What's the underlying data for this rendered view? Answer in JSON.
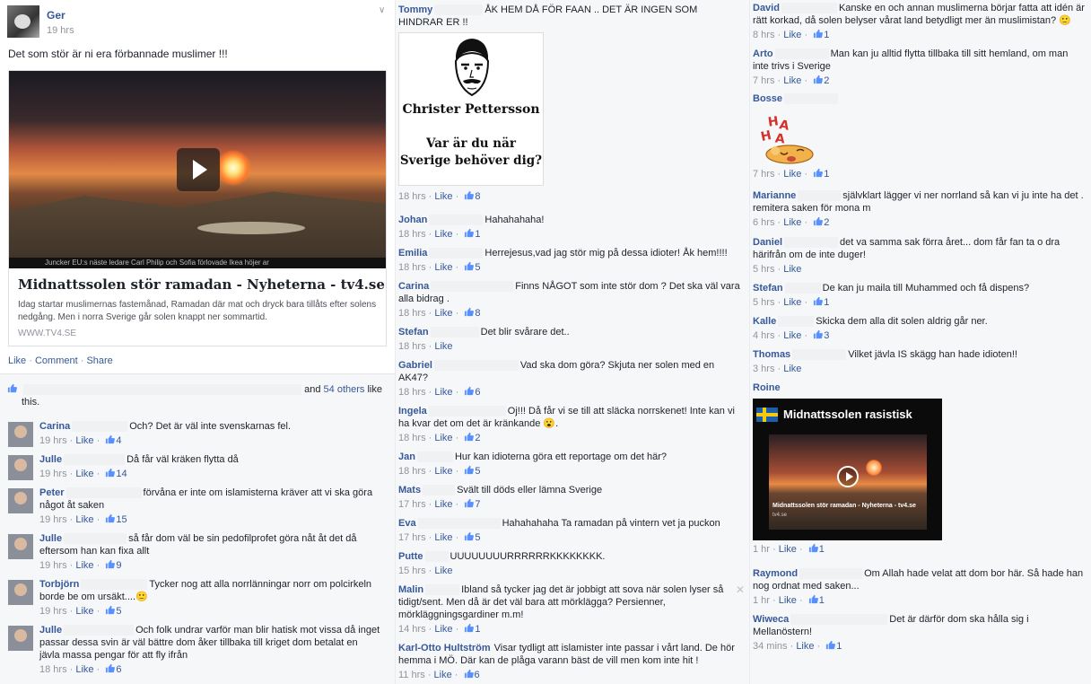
{
  "post": {
    "author": "Ger",
    "time": "19 hrs",
    "text": "Det som stör är ni era förbannade muslimer !!!",
    "card": {
      "title": "Midnattssolen stör ramadan - Nyheterna - tv4.se",
      "description": "Idag startar muslimernas fastemånad, Ramadan där mat och dryck bara tillåts efter solens nedgång. Men i norra Sverige går solen knappt ner sommartid.",
      "source": "WWW.TV4.SE",
      "ticker": "Juncker EU:s näste ledare        Carl Philip och Sofia förlovade        Ikea höjer ar"
    },
    "actions": {
      "like": "Like",
      "comment": "Comment",
      "share": "Share",
      "sep": " · "
    },
    "likes_text": "and",
    "likes_others": "54 others",
    "likes_suffix": "like",
    "likes_line2": "this."
  },
  "comments_col1": [
    {
      "name": "Carina",
      "text": "Och? Det är väl inte svenskarnas fel.",
      "time": "19 hrs",
      "likes": "4"
    },
    {
      "name": "Julle",
      "text": "Då får väl kräken flytta då",
      "time": "19 hrs",
      "likes": "14"
    },
    {
      "name": "Peter",
      "text": "förvåna er inte om islamisterna kräver att vi ska göra något åt saken",
      "time": "19 hrs",
      "likes": "15"
    },
    {
      "name": "Julle",
      "text": "så får dom väl be sin pedofilprofet göra nåt åt det då eftersom han kan fixa allt",
      "time": "19 hrs",
      "likes": "9"
    },
    {
      "name": "Torbjörn",
      "text": "Tycker nog att alla norrlänningar norr om polcirkeln borde be om ursäkt....🙂",
      "time": "19 hrs",
      "likes": "5"
    },
    {
      "name": "Julle",
      "text": "Och folk undrar varför man blir hatisk mot vissa då inget passar dessa svin är väl bättre dom åker tillbaka till kriget dom betalat en jävla massa pengar för att fly ifrån",
      "time": "18 hrs",
      "likes": "6"
    }
  ],
  "comments_col2": [
    {
      "name": "Tommy",
      "text": "ÅK HEM DÅ FÖR FAAN .. DET ÄR INGEN SOM HINDRAR ER !!",
      "time": "18 hrs",
      "likes": "8"
    },
    {
      "name": "Johan",
      "text": "Hahahahaha!",
      "time": "18 hrs",
      "likes": "1"
    },
    {
      "name": "Emilia",
      "text": "Herrejesus,vad jag stör mig på dessa idioter! Åk hem!!!!",
      "time": "18 hrs",
      "likes": "5"
    },
    {
      "name": "Carina",
      "text": "Finns NÅGOT som inte stör dom ? Det ska väl vara alla bidrag .",
      "time": "18 hrs",
      "likes": "8"
    },
    {
      "name": "Stefan",
      "text": "Det blir svårare det..",
      "time": "18 hrs",
      "likes": ""
    },
    {
      "name": "Gabriel",
      "text": "Vad ska dom göra? Skjuta ner solen med en AK47?",
      "time": "18 hrs",
      "likes": "6"
    },
    {
      "name": "Ingela",
      "text": "Oj!!! Då får vi se till att släcka norrskenet! Inte kan vi ha kvar det om det är kränkande 😮.",
      "time": "18 hrs",
      "likes": "2"
    },
    {
      "name": "Jan",
      "text": "Hur kan idioterna göra ett reportage om det här?",
      "time": "18 hrs",
      "likes": "5"
    },
    {
      "name": "Mats",
      "text": "Svält till döds eller lämna Sverige",
      "time": "17 hrs",
      "likes": "7"
    },
    {
      "name": "Eva",
      "text": "Hahahahaha Ta ramadan på vintern vet ja puckon",
      "time": "17 hrs",
      "likes": "5"
    },
    {
      "name": "Putte",
      "text": "UUUUUUUURRRRRRKKKKKKKK.",
      "time": "15 hrs",
      "likes": ""
    },
    {
      "name": "Malin",
      "text": "Ibland så tycker jag det är jobbigt att sova när solen lyser så tidigt/sent. Men då är det väl bara att mörklägga? Persienner, mörkläggningsgardiner m.m!",
      "time": "14 hrs",
      "likes": "1"
    },
    {
      "name": "Karl-Otto Hultström",
      "text": "Visar tydligt att islamister inte passar i vårt land. De hör hemma i MÖ. Där kan de plåga varann bäst de vill men kom inte hit !",
      "time": "11 hrs",
      "likes": "6"
    }
  ],
  "christer_image": {
    "name": "Christer Pettersson",
    "question": "Var är du när Sverige behöver dig?"
  },
  "comments_col3": [
    {
      "name": "David",
      "text": "Kanske en och annan muslimerna börjar fatta att idén är rätt korkad, då solen belyser vårat land betydligt mer än muslimistan? 🙂",
      "time": "8 hrs",
      "likes": "1"
    },
    {
      "name": "Arto",
      "text": "Man kan ju alltid flytta tillbaka till sitt hemland, om man inte trivs i Sverige",
      "time": "7 hrs",
      "likes": "2"
    },
    {
      "name": "Bosse",
      "text": "",
      "time": "7 hrs",
      "likes": "1"
    },
    {
      "name": "Marianne",
      "text": "självklart lägger vi ner norrland så kan vi ju inte ha det . remitera saken för mona m",
      "time": "6 hrs",
      "likes": "2"
    },
    {
      "name": "Daniel",
      "text": "det va samma sak förra året... dom får fan ta o dra härifrån om de inte duger!",
      "time": "5 hrs",
      "likes": ""
    },
    {
      "name": "Stefan",
      "text": "De kan ju maila till Muhammed och få dispens?",
      "time": "5 hrs",
      "likes": "1"
    },
    {
      "name": "Kalle",
      "text": "Skicka dem alla dit solen aldrig går ner.",
      "time": "4 hrs",
      "likes": "3"
    },
    {
      "name": "Thomas",
      "text": "Vilket jävla IS skägg han hade idioten!!",
      "time": "3 hrs",
      "likes": ""
    },
    {
      "name": "Roine",
      "text": "",
      "time": "1 hr",
      "likes": "1"
    },
    {
      "name": "Raymond",
      "text": "Om Allah hade velat att dom bor här. Så hade han nog ordnat med saken...",
      "time": "1 hr",
      "likes": "1"
    },
    {
      "name": "Wiweca",
      "text": "Det är därför dom ska hålla sig i Mellanöstern!",
      "time": "34 mins",
      "likes": "1"
    }
  ],
  "sticker": {
    "text": "HAHA"
  },
  "roine_video": {
    "title": "Midnattssolen rasistisk",
    "caption": "Midnattssolen stör ramadan - Nyheterna - tv4.se",
    "caption_src": "tv4.se"
  },
  "ui": {
    "like_label": "Like",
    "sep": " · ",
    "close": "✕",
    "chevron": "∨"
  }
}
